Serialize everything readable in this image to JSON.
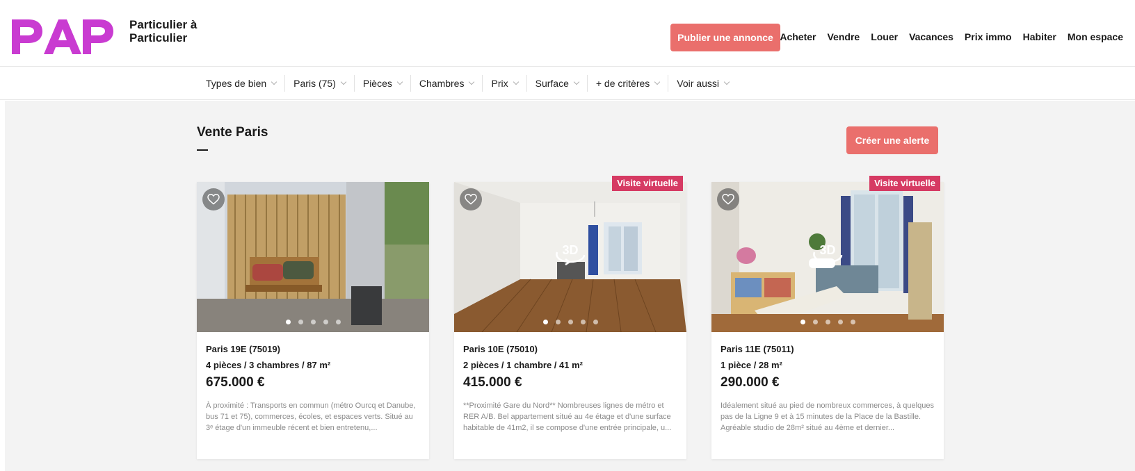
{
  "header": {
    "logo_text": "PAP",
    "tagline_line1": "Particulier à",
    "tagline_line2": "Particulier",
    "publish_label": "Publier une annonce",
    "nav": [
      "Acheter",
      "Vendre",
      "Louer",
      "Vacances",
      "Prix immo",
      "Habiter",
      "Mon espace"
    ]
  },
  "filters": [
    "Types de bien",
    "Paris (75)",
    "Pièces",
    "Chambres",
    "Prix",
    "Surface",
    "+ de critères",
    "Voir aussi"
  ],
  "main": {
    "title": "Vente Paris",
    "alert_label": "Créer une alerte"
  },
  "listings": [
    {
      "location": "Paris 19E (75019)",
      "specs": "4 pièces / 3 chambres / 87 m²",
      "price": "675.000 €",
      "description": "À proximité : Transports en commun (métro Ourcq et Danube, bus 71 et 75), commerces, écoles, et espaces verts. Situé au 3ᵉ étage d'un immeuble récent et bien entretenu,...",
      "badge": "",
      "has_3d": false
    },
    {
      "location": "Paris 10E (75010)",
      "specs": "2 pièces / 1 chambre / 41 m²",
      "price": "415.000 €",
      "description": "**Proximité Gare du Nord** Nombreuses lignes de métro et RER A/B. Bel appartement situé au 4e étage et d'une surface habitable de 41m2, il se compose d'une entrée principale, u...",
      "badge": "Visite virtuelle",
      "has_3d": true
    },
    {
      "location": "Paris 11E (75011)",
      "specs": "1 pièce / 28 m²",
      "price": "290.000 €",
      "description": "Idéalement situé au pied de nombreux commerces, à quelques pas de la Ligne 9 et à 15 minutes de la Place de la Bastille. Agréable studio de 28m² situé au 4ème et dernier...",
      "badge": "Visite virtuelle",
      "has_3d": true
    }
  ],
  "icons": {
    "favorite": "heart-outline-icon",
    "virtual_tour": "3d-tour-icon",
    "dropdown": "chevron-down-icon"
  },
  "colors": {
    "brand": "#c93bd1",
    "accent_button": "#ea6f6c",
    "badge": "#d63a63"
  }
}
